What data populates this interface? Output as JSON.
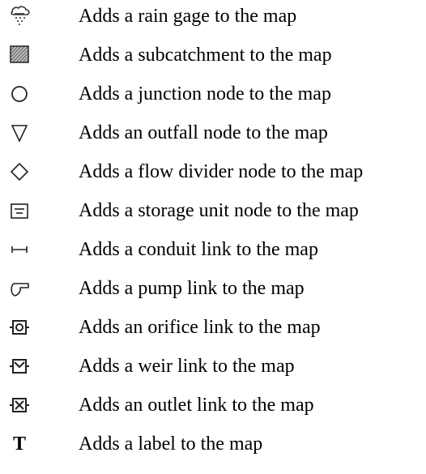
{
  "items": [
    {
      "icon": "rain-gage-icon",
      "text": "Adds a rain gage to the map"
    },
    {
      "icon": "subcatchment-icon",
      "text": "Adds a subcatchment to the map"
    },
    {
      "icon": "junction-node-icon",
      "text": "Adds a junction node to the map"
    },
    {
      "icon": "outfall-node-icon",
      "text": "Adds an outfall node to the map"
    },
    {
      "icon": "flow-divider-icon",
      "text": "Adds a flow divider node to the map"
    },
    {
      "icon": "storage-unit-icon",
      "text": "Adds a storage unit node to the map"
    },
    {
      "icon": "conduit-link-icon",
      "text": "Adds a conduit link to the map"
    },
    {
      "icon": "pump-link-icon",
      "text": "Adds a pump link to the map"
    },
    {
      "icon": "orifice-link-icon",
      "text": "Adds an orifice link to the map"
    },
    {
      "icon": "weir-link-icon",
      "text": "Adds a weir link to the map"
    },
    {
      "icon": "outlet-link-icon",
      "text": "Adds an outlet link to the map"
    },
    {
      "icon": "label-icon",
      "text": "Adds a label to the map",
      "glyph": "T"
    }
  ]
}
